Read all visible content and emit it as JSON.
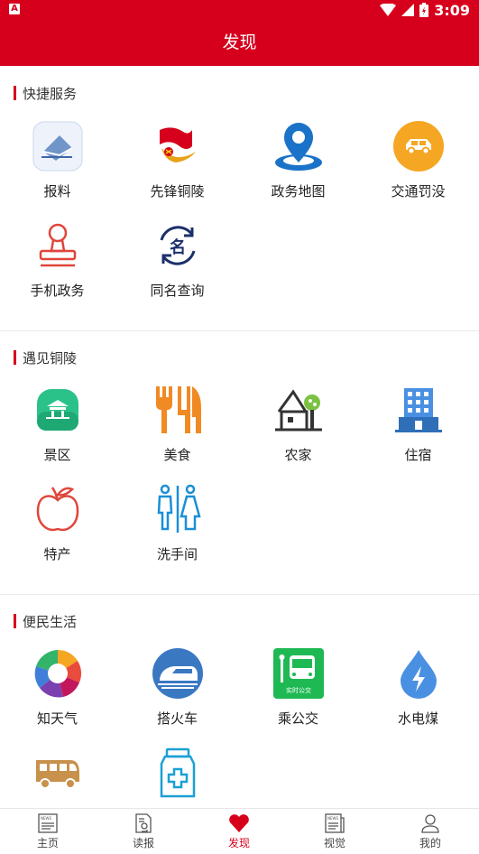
{
  "status": {
    "time": "3:09",
    "app_badge": "A"
  },
  "header": {
    "title": "发现"
  },
  "sections": [
    {
      "title": "快捷服务",
      "items": [
        {
          "label": "报料",
          "icon": "envelope-icon"
        },
        {
          "label": "先锋铜陵",
          "icon": "party-flag-icon"
        },
        {
          "label": "政务地图",
          "icon": "map-pin-icon"
        },
        {
          "label": "交通罚没",
          "icon": "car-icon"
        },
        {
          "label": "手机政务",
          "icon": "stamp-icon"
        },
        {
          "label": "同名查询",
          "icon": "name-search-icon"
        }
      ]
    },
    {
      "title": "遇见铜陵",
      "items": [
        {
          "label": "景区",
          "icon": "scenic-icon"
        },
        {
          "label": "美食",
          "icon": "food-icon"
        },
        {
          "label": "农家",
          "icon": "farmhouse-icon"
        },
        {
          "label": "住宿",
          "icon": "hotel-icon"
        },
        {
          "label": "特产",
          "icon": "apple-icon"
        },
        {
          "label": "洗手间",
          "icon": "restroom-icon"
        }
      ]
    },
    {
      "title": "便民生活",
      "items": [
        {
          "label": "知天气",
          "icon": "weather-icon"
        },
        {
          "label": "搭火车",
          "icon": "train-icon"
        },
        {
          "label": "乘公交",
          "icon": "bus-stop-icon",
          "badge": "实时公交"
        },
        {
          "label": "水电煤",
          "icon": "water-drop-icon"
        },
        {
          "label": "",
          "icon": "bus-icon"
        },
        {
          "label": "",
          "icon": "medicine-icon"
        }
      ]
    }
  ],
  "bottom_nav": [
    {
      "label": "主页",
      "icon": "news-icon",
      "active": false
    },
    {
      "label": "读报",
      "icon": "newspaper-read-icon",
      "active": false
    },
    {
      "label": "发现",
      "icon": "heart-icon",
      "active": true
    },
    {
      "label": "视觉",
      "icon": "news-video-icon",
      "active": false
    },
    {
      "label": "我的",
      "icon": "user-icon",
      "active": false
    }
  ],
  "colors": {
    "brand_red": "#d6001c",
    "map_blue": "#1a73c8",
    "car_orange": "#f5a623",
    "food_orange": "#f08a24",
    "hotel_blue": "#4a90e2",
    "restroom_blue": "#1a8fd6",
    "bus_green": "#1fb954",
    "scenic_green": "#2bc28a"
  }
}
